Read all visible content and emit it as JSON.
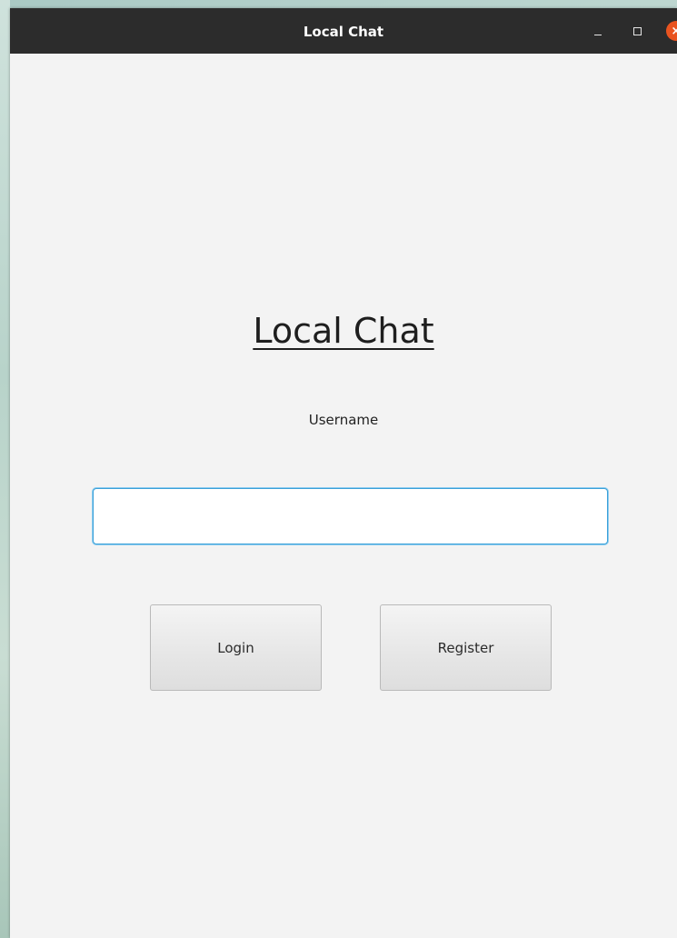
{
  "window": {
    "title": "Local Chat",
    "controls": {
      "minimize_icon": "minimize-icon",
      "maximize_icon": "maximize-icon",
      "close_icon": "close-icon",
      "close_glyph": "×",
      "close_color": "#e95420"
    }
  },
  "main": {
    "heading": "Local Chat",
    "username_label": "Username",
    "username_value": "",
    "login_label": "Login",
    "register_label": "Register"
  },
  "colors": {
    "titlebar": "#2c2c2c",
    "window_bg": "#f3f3f3",
    "input_focus": "#3aa0d8"
  }
}
